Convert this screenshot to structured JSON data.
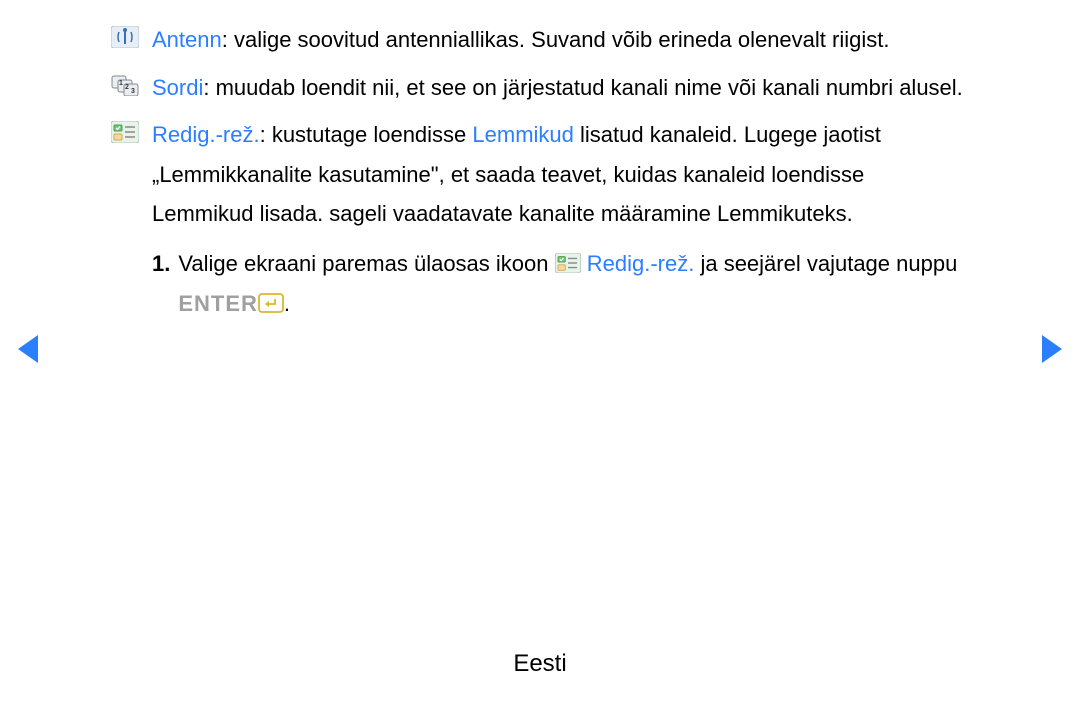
{
  "items": {
    "antenn": {
      "label": "Antenn",
      "text": ": valige soovitud antenniallikas. Suvand võib erineda olenevalt riigist."
    },
    "sordi": {
      "label": "Sordi",
      "text": ": muudab loendit nii, et see on järjestatud kanali nime või kanali numbri alusel."
    },
    "redig": {
      "label": "Redig.-rež.",
      "text_a": ": kustutage loendisse ",
      "highlight": "Lemmikud",
      "text_b": " lisatud kanaleid. Lugege jaotist „Lemmikkanalite kasutamine\", et saada teavet, kuidas kanaleid loendisse Lemmikud lisada. sageli vaadatavate kanalite määramine Lemmikuteks."
    }
  },
  "numbered": {
    "num": "1.",
    "text_a": "Valige ekraani paremas ülaosas ikoon ",
    "label_after_icon": " Redig.-rež.",
    "text_b": " ja seejärel vajutage nuppu ",
    "enter_label": "ENTER",
    "text_c": "."
  },
  "footer": "Eesti"
}
